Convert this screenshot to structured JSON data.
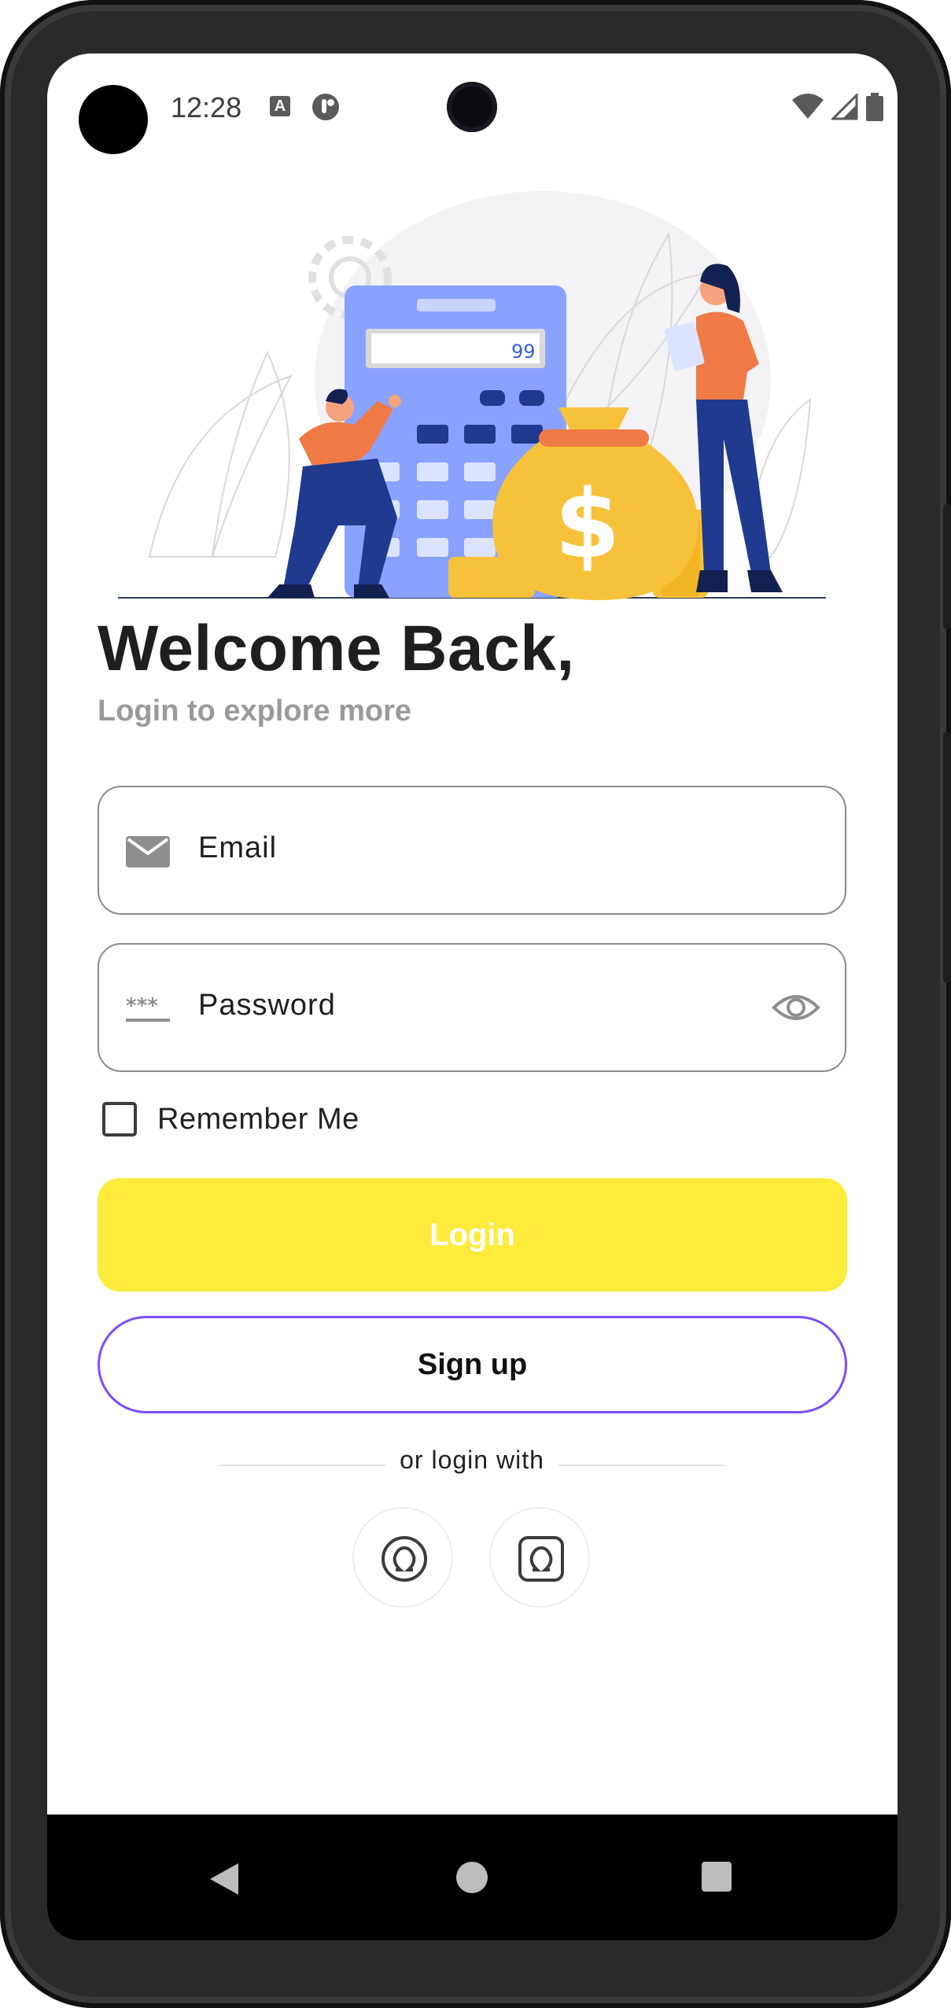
{
  "status_bar": {
    "time": "12:28",
    "notification_icons": [
      "app-a-icon",
      "app-b-icon"
    ],
    "system_icons": [
      "wifi-icon",
      "signal-icon",
      "battery-icon"
    ]
  },
  "illustration": {
    "calculator_display": "99",
    "bag_symbol": "$"
  },
  "header": {
    "title": "Welcome Back,",
    "subtitle": "Login to explore more"
  },
  "form": {
    "email": {
      "label": "Email",
      "icon": "mail-icon"
    },
    "password": {
      "label": "Password",
      "icon": "password-dots-icon",
      "toggle_icon": "eye-icon"
    },
    "remember_me": {
      "label": "Remember Me",
      "checked": false
    }
  },
  "actions": {
    "login_label": "Login",
    "signup_label": "Sign up",
    "or_text": "or login with"
  },
  "social_logins": [
    "omega-circle-icon",
    "omega-square-icon"
  ],
  "colors": {
    "accent_yellow": "#ffeb3b",
    "signup_border": "#7c4dff",
    "title_text": "#1f1f1f",
    "subtitle_text": "#9a9a9a"
  }
}
